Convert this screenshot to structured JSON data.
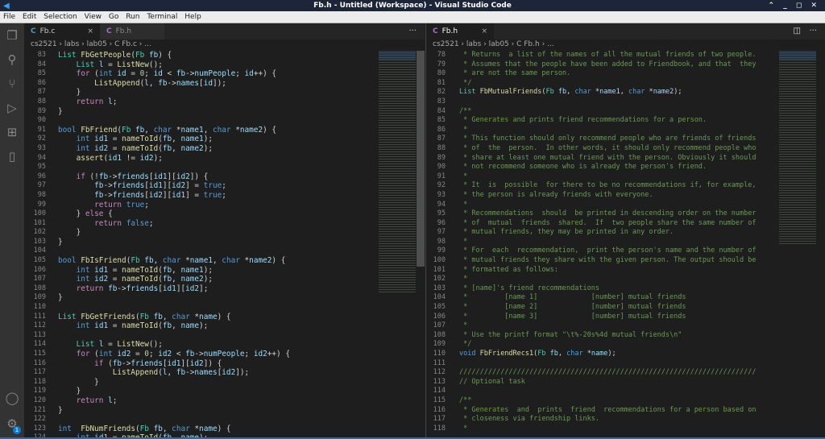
{
  "window": {
    "title": "Fb.h - Untitled (Workspace) - Visual Studio Code",
    "controls": "⌃ _ ◻ ✕"
  },
  "menu": [
    "File",
    "Edit",
    "Selection",
    "View",
    "Go",
    "Run",
    "Terminal",
    "Help"
  ],
  "activity": {
    "badge": "1"
  },
  "left": {
    "tabs": [
      {
        "label": "Fb.c",
        "icon": "C",
        "close": "×"
      },
      {
        "label": "Fb.h",
        "icon": "C"
      }
    ],
    "more": "···",
    "breadcrumb": "cs2521 › labs › lab05 › C Fb.c › ...",
    "start": 83,
    "lines": [
      "List FbGetPeople(Fb fb) {",
      "    List l = ListNew();",
      "    for (int id = 0; id < fb->numPeople; id++) {",
      "        ListAppend(l, fb->names[id]);",
      "    }",
      "    return l;",
      "}",
      "",
      "bool FbFriend(Fb fb, char *name1, char *name2) {",
      "    int id1 = nameToId(fb, name1);",
      "    int id2 = nameToId(fb, name2);",
      "    assert(id1 != id2);",
      "",
      "    if (!fb->friends[id1][id2]) {",
      "        fb->friends[id1][id2] = true;",
      "        fb->friends[id2][id1] = true;",
      "        return true;",
      "    } else {",
      "        return false;",
      "    }",
      "}",
      "",
      "bool FbIsFriend(Fb fb, char *name1, char *name2) {",
      "    int id1 = nameToId(fb, name1);",
      "    int id2 = nameToId(fb, name2);",
      "    return fb->friends[id1][id2];",
      "}",
      "",
      "List FbGetFriends(Fb fb, char *name) {",
      "    int id1 = nameToId(fb, name);",
      "",
      "    List l = ListNew();",
      "    for (int id2 = 0; id2 < fb->numPeople; id2++) {",
      "        if (fb->friends[id1][id2]) {",
      "            ListAppend(l, fb->names[id2]);",
      "        }",
      "    }",
      "    return l;",
      "}",
      "",
      "int  FbNumFriends(Fb fb, char *name) {",
      "    int id1 = nameToId(fb, name);"
    ]
  },
  "right": {
    "tabs": [
      {
        "label": "Fb.h",
        "icon": "C",
        "close": "×"
      }
    ],
    "split": "◫",
    "more": "···",
    "breadcrumb": "cs2521 › labs › lab05 › C Fb.h › ...",
    "start": 78,
    "lines": [
      " * Returns  a list of the names of all the mutual friends of two people.",
      " * Assumes that the people have been added to Friendbook, and that  they",
      " * are not the same person.",
      " */",
      "List FbMutualFriends(Fb fb, char *name1, char *name2);",
      "",
      "/**",
      " * Generates and prints friend recommendations for a person.",
      " *",
      " * This function should only recommend people who are friends of friends",
      " * of  the  person.  In other words, it should only recommend people who",
      " * share at least one mutual friend with the person. Obviously it should",
      " * not recommend someone who is already the person's friend.",
      " *",
      " * It  is  possible  for there to be no recommendations if, for example,",
      " * the person is already friends with everyone.",
      " *",
      " * Recommendations  should  be printed in descending order on the number",
      " * of  mutual  friends  shared.  If  two people share the same number of",
      " * mutual friends, they may be printed in any order.",
      " *",
      " * For  each  recommendation,  print the person's name and the number of",
      " * mutual friends they share with the given person. The output should be",
      " * formatted as follows:",
      " *",
      " * [name]'s friend recommendations",
      " *         [name 1]             [number] mutual friends",
      " *         [name 2]             [number] mutual friends",
      " *         [name 3]             [number] mutual friends",
      " *",
      " * Use the printf format \"\\t%-20s%4d mutual friends\\n\"",
      " */",
      "void FbFriendRecs1(Fb fb, char *name);",
      "",
      "////////////////////////////////////////////////////////////////////////",
      "// Optional task",
      "",
      "/**",
      " * Generates  and  prints  friend  recommendations for a person based on",
      " * closeness via friendship links.",
      " *"
    ]
  }
}
